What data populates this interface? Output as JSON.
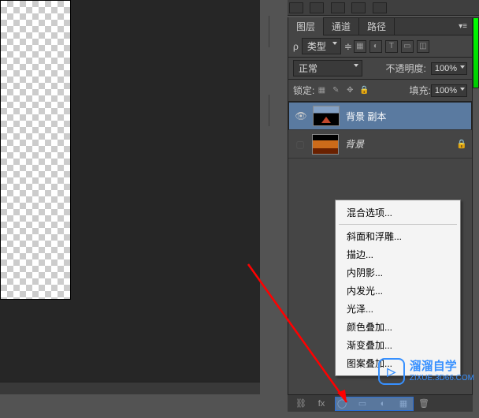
{
  "tabs": {
    "layers": "图层",
    "channels": "通道",
    "paths": "路径"
  },
  "filter": {
    "label": "类型"
  },
  "blend": {
    "mode": "正常",
    "opacity_label": "不透明度:",
    "opacity": "100%"
  },
  "lock": {
    "label": "锁定:",
    "fill_label": "填充:",
    "fill": "100%"
  },
  "layer1": {
    "name": "背景 副本"
  },
  "layer2": {
    "name": "背景"
  },
  "ctx": {
    "blend_options": "混合选项...",
    "bevel": "斜面和浮雕...",
    "stroke": "描边...",
    "inner_shadow": "内阴影...",
    "inner_glow": "内发光...",
    "satin": "光泽...",
    "color_overlay": "颜色叠加...",
    "gradient_overlay": "渐变叠加...",
    "pattern_overlay": "图案叠加..."
  },
  "watermark": {
    "brand": "溜溜自学",
    "url": "ZIXUE.3D66.COM"
  }
}
